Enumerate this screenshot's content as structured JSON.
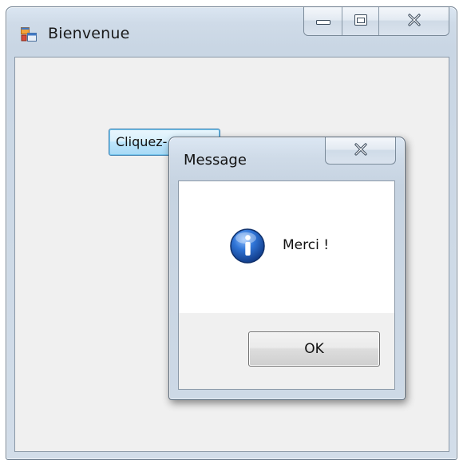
{
  "main_window": {
    "title": "Bienvenue",
    "app_icon": "form-app-icon",
    "caption_buttons": {
      "minimize_icon": "minimize-icon",
      "maximize_icon": "maximize-icon",
      "close_icon": "close-icon"
    },
    "button_label": "Cliquez-"
  },
  "dialog": {
    "title": "Message",
    "close_icon": "close-icon",
    "icon": "information-icon",
    "message": "Merci !",
    "ok_label": "OK"
  },
  "colors": {
    "button_highlight": "#bee6fd",
    "info_icon_blue": "#1f5fbf"
  }
}
